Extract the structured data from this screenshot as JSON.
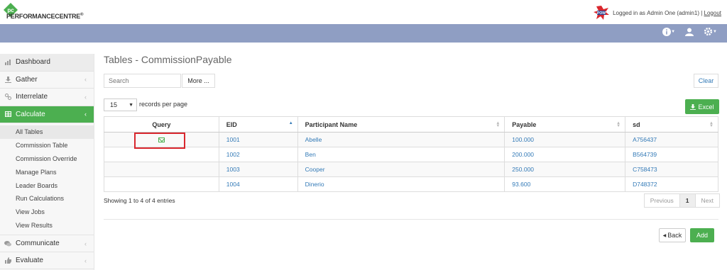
{
  "brand": {
    "logo_initials": "pc",
    "name": "PERFORMANCECENTRE",
    "mark": "®"
  },
  "user": {
    "prefix": "Logged in as",
    "name": "Admin One (admin1)",
    "separator": "|",
    "logout": "Logout"
  },
  "navbar": {
    "icons": [
      "info-icon",
      "user-icon",
      "gear-icon"
    ],
    "color": "#8f9ec3"
  },
  "sidebar": {
    "items": [
      {
        "label": "Dashboard",
        "icon": "chart-icon"
      },
      {
        "label": "Gather",
        "icon": "download-icon"
      },
      {
        "label": "Interrelate",
        "icon": "link-icon"
      },
      {
        "label": "Calculate",
        "icon": "table-icon"
      }
    ],
    "sub_items": [
      "All Tables",
      "Commission Table",
      "Commission Override",
      "Manage Plans",
      "Leader Boards",
      "Run Calculations",
      "View Jobs",
      "View Results"
    ],
    "bottom_items": [
      {
        "label": "Communicate",
        "icon": "comments-icon"
      },
      {
        "label": "Evaluate",
        "icon": "thumbs-up-icon"
      }
    ]
  },
  "page": {
    "title": "Tables - CommissionPayable",
    "search_placeholder": "Search",
    "more_label": "More ...",
    "clear_label": "Clear",
    "rpp_value": "15",
    "rpp_label": "records per page",
    "excel_label": "Excel"
  },
  "table": {
    "columns": [
      "Query",
      "EID",
      "Participant Name",
      "Payable",
      "sd"
    ],
    "rows": [
      [
        "1001",
        "Abelle",
        "100.000",
        "A756437"
      ],
      [
        "1002",
        "Ben",
        "200.000",
        "B564739"
      ],
      [
        "1003",
        "Cooper",
        "250.000",
        "C758473"
      ],
      [
        "1004",
        "Dinerio",
        "93.600",
        "D748372"
      ]
    ]
  },
  "footer": {
    "info": "Showing 1 to 4 of 4 entries",
    "prev": "Previous",
    "page": "1",
    "next": "Next",
    "back_label": "Back",
    "add_label": "Add"
  },
  "colors": {
    "accent": "#4caf50",
    "link": "#337ab7",
    "highlight": "#d9272e"
  }
}
